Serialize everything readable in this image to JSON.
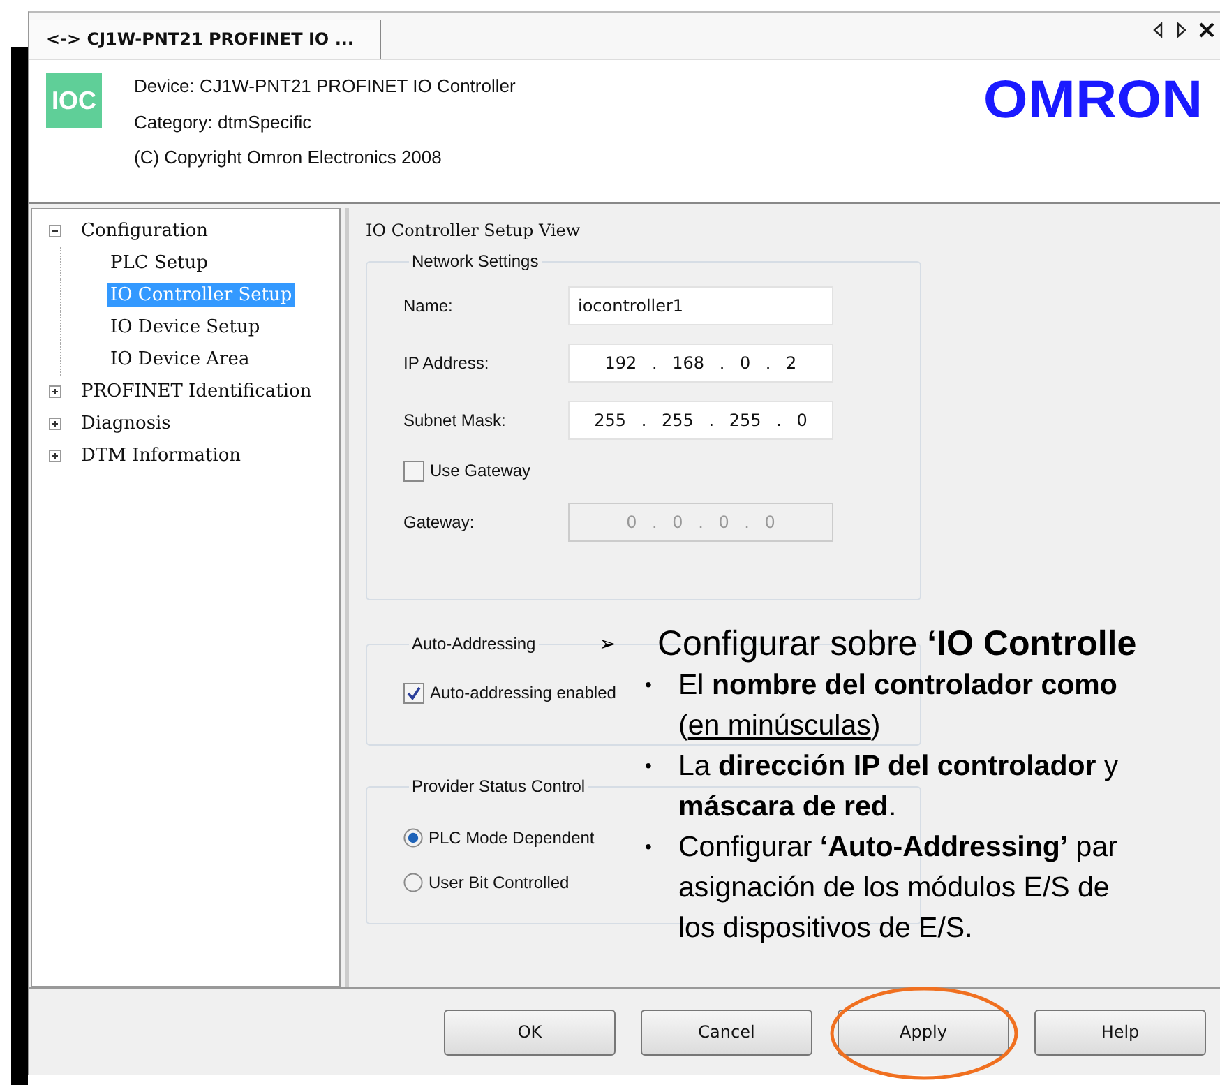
{
  "window": {
    "tab_title": "<-> CJ1W-PNT21 PROFINET IO ..."
  },
  "header": {
    "icon_text": "IOC",
    "lines": [
      "Device:  CJ1W-PNT21 PROFINET IO Controller",
      "Category:  dtmSpecific",
      "(C) Copyright Omron Electronics 2008"
    ],
    "logo": "OMRON"
  },
  "tree": [
    {
      "label": "Configuration",
      "expanded": true,
      "selected": false,
      "children": [
        {
          "label": "PLC Setup",
          "selected": false
        },
        {
          "label": "IO Controller Setup",
          "selected": true
        },
        {
          "label": "IO Device Setup",
          "selected": false
        },
        {
          "label": "IO Device Area",
          "selected": false
        }
      ]
    },
    {
      "label": "PROFINET Identification",
      "expanded": false,
      "selected": false
    },
    {
      "label": "Diagnosis",
      "expanded": false,
      "selected": false
    },
    {
      "label": "DTM Information",
      "expanded": false,
      "selected": false
    }
  ],
  "panel": {
    "title": "IO Controller Setup View",
    "network": {
      "legend": "Network Settings",
      "fields": [
        {
          "kind": "text",
          "label": "Name:",
          "value": "iocontroller1",
          "disabled": false
        },
        {
          "kind": "ip",
          "label": "IP Address:",
          "value": "192 . 168 . 0 . 2",
          "disabled": false
        },
        {
          "kind": "ip",
          "label": "Subnet Mask:",
          "value": "255 . 255 . 255 . 0",
          "disabled": false
        },
        {
          "kind": "checkbox",
          "label": "Use Gateway",
          "checked": false
        },
        {
          "kind": "ip",
          "label": "Gateway:",
          "value": "0 . 0 . 0 . 0",
          "disabled": true
        }
      ]
    },
    "auto": {
      "legend": "Auto-Addressing",
      "checkbox": {
        "label": "Auto-addressing enabled",
        "checked": true
      }
    },
    "provider": {
      "legend": "Provider Status Control",
      "options": [
        {
          "label": "PLC Mode Dependent",
          "selected": true
        },
        {
          "label": "User Bit Controlled",
          "selected": false
        }
      ]
    }
  },
  "buttons": [
    {
      "label": "OK",
      "highlighted": false
    },
    {
      "label": "Cancel",
      "highlighted": false
    },
    {
      "label": "Apply",
      "highlighted": true
    },
    {
      "label": "Help",
      "highlighted": false
    }
  ],
  "callout": {
    "marker": "➢",
    "heading": "Configurar sobre **‘IO Controlle**",
    "bullets": [
      {
        "bullet": "•",
        "lines": [
          [
            {
              "text": "El **nombre del controlador como**",
              "underline": false
            }
          ],
          [
            {
              "text": "(",
              "underline": false
            },
            {
              "text": "en minúsculas",
              "underline": true
            },
            {
              "text": ")",
              "underline": false
            }
          ]
        ]
      },
      {
        "bullet": "•",
        "lines": [
          [
            {
              "text": "La **dirección IP del controlador** y",
              "underline": false
            }
          ],
          [
            {
              "text": "**máscara de red**.",
              "underline": false
            }
          ]
        ]
      },
      {
        "bullet": "•",
        "lines": [
          [
            {
              "text": "Configurar **‘Auto-Addressing’** par",
              "underline": false
            }
          ],
          [
            {
              "text": "asignación de los módulos E/S de",
              "underline": false
            }
          ],
          [
            {
              "text": "los dispositivos de E/S.",
              "underline": false
            }
          ]
        ]
      }
    ]
  }
}
